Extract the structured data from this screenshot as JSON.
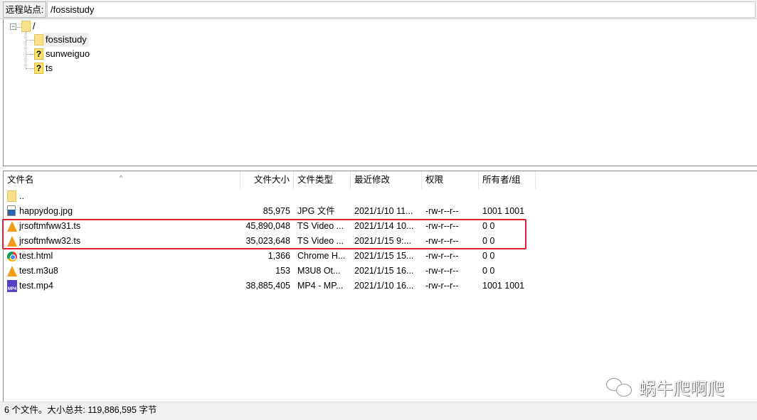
{
  "address": {
    "label": "远程站点:",
    "path": "/fossistudy"
  },
  "tree": {
    "root": "/",
    "children": [
      {
        "name": "fossistudy",
        "icon": "folder",
        "selected": true
      },
      {
        "name": "sunweiguo",
        "icon": "unknown"
      },
      {
        "name": "ts",
        "icon": "unknown"
      }
    ]
  },
  "columns": [
    "文件名",
    "文件大小",
    "文件类型",
    "最近修改",
    "权限",
    "所有者/组"
  ],
  "files": [
    {
      "name": "..",
      "size": "",
      "type": "",
      "modified": "",
      "perms": "",
      "owner": "",
      "icon": "folder"
    },
    {
      "name": "happydog.jpg",
      "size": "85,975",
      "type": "JPG 文件",
      "modified": "2021/1/10 11...",
      "perms": "-rw-r--r--",
      "owner": "1001 1001",
      "icon": "image"
    },
    {
      "name": "jrsoftmfww31.ts",
      "size": "45,890,048",
      "type": "TS Video ...",
      "modified": "2021/1/14 10...",
      "perms": "-rw-r--r--",
      "owner": "0 0",
      "icon": "vlc",
      "highlighted": true
    },
    {
      "name": "jrsoftmfww32.ts",
      "size": "35,023,648",
      "type": "TS Video ...",
      "modified": "2021/1/15 9:...",
      "perms": "-rw-r--r--",
      "owner": "0 0",
      "icon": "vlc",
      "highlighted": true
    },
    {
      "name": "test.html",
      "size": "1,366",
      "type": "Chrome H...",
      "modified": "2021/1/15 15...",
      "perms": "-rw-r--r--",
      "owner": "0 0",
      "icon": "chrome"
    },
    {
      "name": "test.m3u8",
      "size": "153",
      "type": "M3U8 Ot...",
      "modified": "2021/1/15 16...",
      "perms": "-rw-r--r--",
      "owner": "0 0",
      "icon": "vlc"
    },
    {
      "name": "test.mp4",
      "size": "38,885,405",
      "type": "MP4 - MP...",
      "modified": "2021/1/10 16...",
      "perms": "-rw-r--r--",
      "owner": "1001 1001",
      "icon": "mp4"
    }
  ],
  "status": "6 个文件。大小总共: 119,886,595 字节",
  "watermark": "蜗牛爬啊爬",
  "colors": {
    "highlight": "#e02030"
  }
}
